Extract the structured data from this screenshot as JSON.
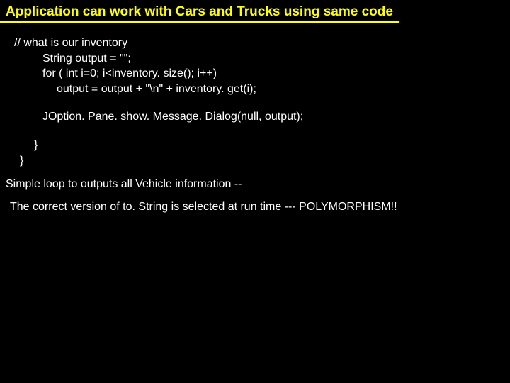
{
  "title": "Application can work with Cars and Trucks using same code",
  "code": {
    "comment": "// what is our inventory",
    "line1": "String output = \"\";",
    "line2": "for ( int i=0; i<inventory. size(); i++)",
    "line3": "output = output + \"\\n\" + inventory. get(i);",
    "line4": "JOption. Pane. show. Message. Dialog(null, output);",
    "close1": "}",
    "close2": "}"
  },
  "desc1": "Simple loop to outputs all Vehicle information --",
  "desc2": "The correct version of to. String is selected at run time --- POLYMORPHISM!!"
}
